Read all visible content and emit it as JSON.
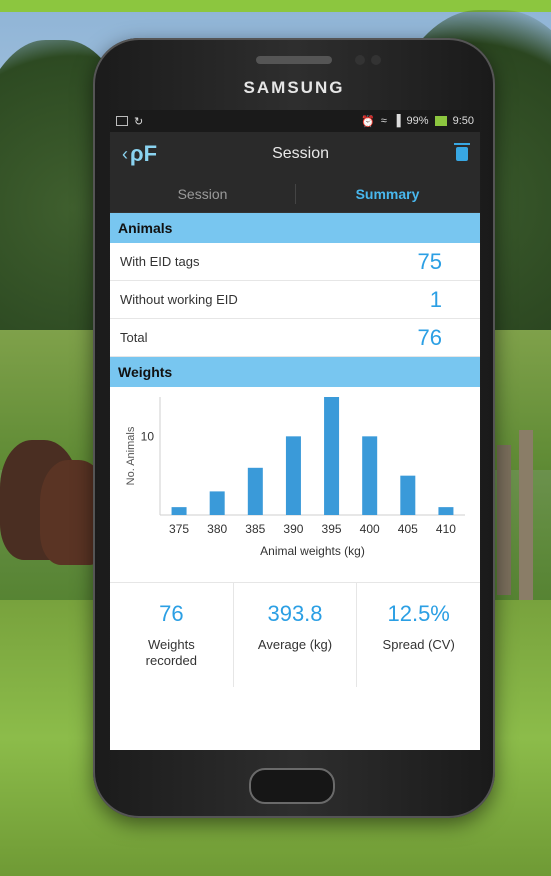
{
  "phone": {
    "brand": "SAMSUNG"
  },
  "status_bar": {
    "battery": "99%",
    "time": "9:50"
  },
  "app_bar": {
    "logo": "ρF",
    "title": "Session"
  },
  "tabs": [
    {
      "label": "Session",
      "active": false
    },
    {
      "label": "Summary",
      "active": true
    }
  ],
  "animals": {
    "header": "Animals",
    "rows": [
      {
        "label": "With EID tags",
        "value": "75"
      },
      {
        "label": "Without working EID",
        "value": "1"
      },
      {
        "label": "Total",
        "value": "76"
      }
    ]
  },
  "weights": {
    "header": "Weights"
  },
  "chart_data": {
    "type": "bar",
    "categories": [
      "375",
      "380",
      "385",
      "390",
      "395",
      "400",
      "405",
      "410"
    ],
    "values": [
      1,
      3,
      6,
      10,
      15,
      10,
      5,
      1
    ],
    "xlabel": "Animal weights (kg)",
    "ylabel": "No. Animals",
    "yticks": [
      "10"
    ],
    "ylim": [
      0,
      15
    ],
    "color": "#3a9ad9"
  },
  "stats": [
    {
      "value": "76",
      "label_line1": "Weights",
      "label_line2": "recorded"
    },
    {
      "value": "393.8",
      "label_line1": "Average (kg)",
      "label_line2": ""
    },
    {
      "value": "12.5%",
      "label_line1": "Spread (CV)",
      "label_line2": ""
    }
  ],
  "colors": {
    "accent": "#2b9fe4",
    "section_header": "#78c6f0",
    "top_bar": "#8cc63f"
  }
}
